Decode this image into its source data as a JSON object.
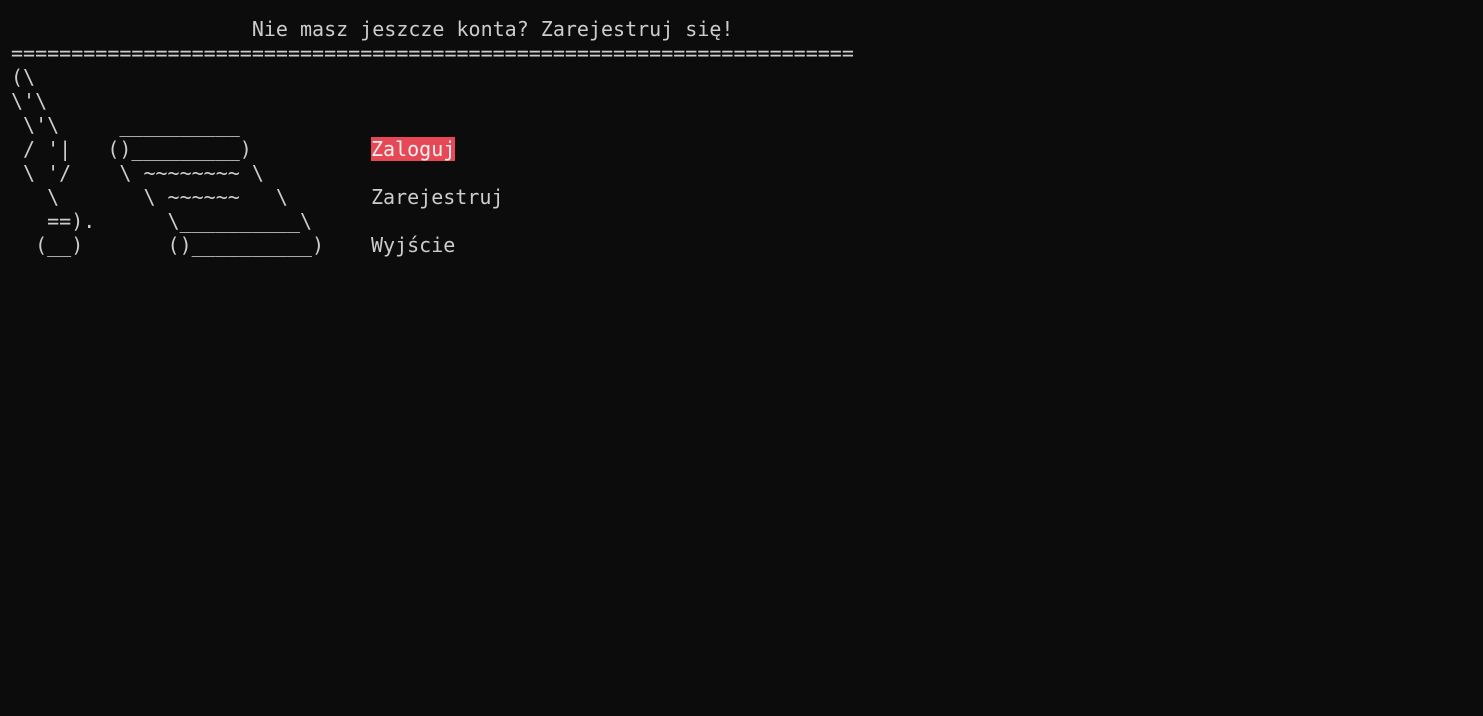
{
  "header": {
    "prompt": "                    Nie masz jeszcze konta? Zarejestruj się!",
    "separator": "======================================================================"
  },
  "art": {
    "lines": [
      "(\\",
      "\\'\\",
      " \\'\\     __________",
      " / '|   ()_________)",
      " \\ '/    \\ ~~~~~~~~ \\",
      "   \\       \\ ~~~~~~   \\",
      "   ==).      \\__________\\",
      "  (__)       ()__________)"
    ]
  },
  "menu": {
    "items": [
      {
        "label": "Zaloguj",
        "selected": true
      },
      {
        "label": "Zarejestruj",
        "selected": false
      },
      {
        "label": "Wyjście",
        "selected": false
      }
    ],
    "highlight_color": "#e74856"
  },
  "colors": {
    "background": "#0c0c0c",
    "foreground": "#cccccc"
  }
}
